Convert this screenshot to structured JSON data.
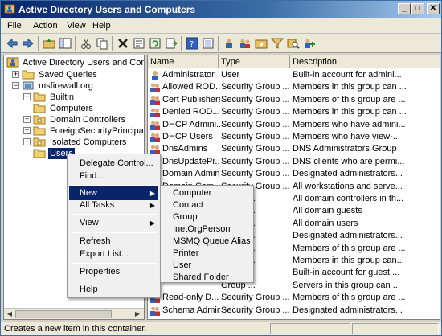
{
  "window": {
    "title": "Active Directory Users and Computers",
    "controls": [
      "_",
      "□",
      "✕"
    ]
  },
  "menubar": {
    "items": [
      "File",
      "Action",
      "View",
      "Help"
    ]
  },
  "toolbar": {
    "icons": [
      "back-icon",
      "forward-icon",
      "up-folder-icon",
      "show-hide-tree-icon",
      "cut-icon",
      "copy-icon",
      "delete-icon",
      "properties-icon",
      "refresh-icon",
      "export-list-icon",
      "help-icon",
      "help-topics-icon",
      "new-user-icon",
      "new-group-icon",
      "new-ou-icon",
      "filter-icon",
      "find-icon",
      "add-to-group-icon"
    ]
  },
  "tree": {
    "root": "Active Directory Users and Comput",
    "items": [
      {
        "label": "Saved Queries",
        "expander": "+",
        "level": 1
      },
      {
        "label": "msfirewall.org",
        "expander": "−",
        "level": 1
      },
      {
        "label": "Builtin",
        "expander": "+",
        "level": 2
      },
      {
        "label": "Computers",
        "expander": "",
        "level": 2
      },
      {
        "label": "Domain Controllers",
        "expander": "+",
        "level": 2
      },
      {
        "label": "ForeignSecurityPrincipals",
        "expander": "+",
        "level": 2
      },
      {
        "label": "Isolated Computers",
        "expander": "+",
        "level": 2
      },
      {
        "label": "Users",
        "expander": "",
        "level": 2,
        "selected": true
      }
    ]
  },
  "list": {
    "columns": [
      "Name",
      "Type",
      "Description"
    ],
    "rows": [
      {
        "name": "Administrator",
        "type": "User",
        "desc": "Built-in account for admini...",
        "icon": "user-icon"
      },
      {
        "name": "Allowed ROD...",
        "type": "Security Group ...",
        "desc": "Members in this group can ...",
        "icon": "group-icon"
      },
      {
        "name": "Cert Publishers",
        "type": "Security Group ...",
        "desc": "Members of this group are ...",
        "icon": "group-icon"
      },
      {
        "name": "Denied ROD...",
        "type": "Security Group ...",
        "desc": "Members in this group can ...",
        "icon": "group-icon"
      },
      {
        "name": "DHCP Admini...",
        "type": "Security Group ...",
        "desc": "Members who have admini...",
        "icon": "group-icon"
      },
      {
        "name": "DHCP Users",
        "type": "Security Group ...",
        "desc": "Members who have view-...",
        "icon": "group-icon"
      },
      {
        "name": "DnsAdmins",
        "type": "Security Group ...",
        "desc": "DNS Administrators Group",
        "icon": "group-icon"
      },
      {
        "name": "DnsUpdatePr...",
        "type": "Security Group ...",
        "desc": "DNS clients who are permi...",
        "icon": "group-icon"
      },
      {
        "name": "Domain Admins",
        "type": "Security Group ...",
        "desc": "Designated administrators...",
        "icon": "group-icon"
      },
      {
        "name": "Domain Com...",
        "type": "Security Group ...",
        "desc": "All workstations and serve...",
        "icon": "group-icon"
      },
      {
        "name": "",
        "type": "Group ...",
        "desc": "All domain controllers in th...",
        "icon": "group-icon"
      },
      {
        "name": "",
        "type": "Group ...",
        "desc": "All domain guests",
        "icon": "group-icon"
      },
      {
        "name": "",
        "type": "Group ...",
        "desc": "All domain users",
        "icon": "group-icon"
      },
      {
        "name": "",
        "type": "Group ...",
        "desc": "Designated administrators...",
        "icon": "group-icon"
      },
      {
        "name": "",
        "type": "Group ...",
        "desc": "Members of this group are ...",
        "icon": "group-icon"
      },
      {
        "name": "",
        "type": "Group ...",
        "desc": "Members in this group can...",
        "icon": "group-icon"
      },
      {
        "name": "",
        "type": "",
        "desc": "Built-in account for guest ...",
        "icon": "user-icon"
      },
      {
        "name": "",
        "type": "Group ...",
        "desc": "Servers in this group can ...",
        "icon": "group-icon"
      },
      {
        "name": "Read-only D...",
        "type": "Security Group ...",
        "desc": "Members of this group are ...",
        "icon": "group-icon"
      },
      {
        "name": "Schema Admins",
        "type": "Security Group ...",
        "desc": "Designated administrators...",
        "icon": "group-icon"
      }
    ]
  },
  "context_menu": {
    "items": [
      "Delegate Control...",
      "Find...",
      "New",
      "All Tasks",
      "View",
      "Refresh",
      "Export List...",
      "Properties",
      "Help"
    ],
    "highlighted": "New"
  },
  "submenu": {
    "items": [
      "Computer",
      "Contact",
      "Group",
      "InetOrgPerson",
      "MSMQ Queue Alias",
      "Printer",
      "User",
      "Shared Folder"
    ]
  },
  "status": {
    "text": "Creates a new item in this container."
  },
  "colors": {
    "title_start": "#0a246a",
    "title_end": "#a6caf0",
    "selection": "#0a246a",
    "chrome": "#ece9d8"
  }
}
